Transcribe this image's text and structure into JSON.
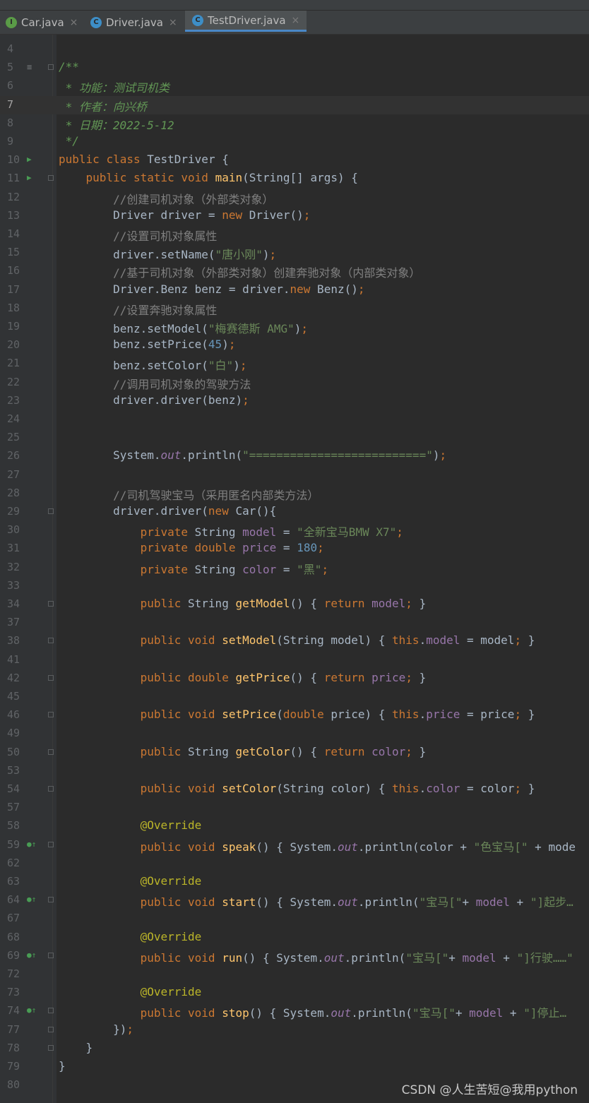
{
  "tabs": [
    {
      "label": "Car.java",
      "icon": "I",
      "icon_color": "#5a9b47",
      "active": false
    },
    {
      "label": "Driver.java",
      "icon": "C",
      "icon_color": "#3d8ec7",
      "active": false
    },
    {
      "label": "TestDriver.java",
      "icon": "C",
      "icon_color": "#3d8ec7",
      "active": true
    }
  ],
  "close_glyph": "×",
  "watermark": "CSDN @人生苦短@我用python",
  "lines": [
    {
      "n": "4",
      "t": ""
    },
    {
      "n": "5",
      "t": "/**"
    },
    {
      "n": "6",
      "t": " * 功能：测试司机类"
    },
    {
      "n": "7",
      "t": " * 作者：向兴桥"
    },
    {
      "n": "8",
      "t": " * 日期：2022-5-12"
    },
    {
      "n": "9",
      "t": " */"
    },
    {
      "n": "10",
      "t": "public class TestDriver {"
    },
    {
      "n": "11",
      "t": "    public static void main(String[] args) {"
    },
    {
      "n": "12",
      "t": "        //创建司机对象（外部类对象）"
    },
    {
      "n": "13",
      "t": "        Driver driver = new Driver();"
    },
    {
      "n": "14",
      "t": "        //设置司机对象属性"
    },
    {
      "n": "15",
      "t": "        driver.setName(\"唐小刚\");"
    },
    {
      "n": "16",
      "t": "        //基于司机对象（外部类对象）创建奔驰对象（内部类对象）"
    },
    {
      "n": "17",
      "t": "        Driver.Benz benz = driver.new Benz();"
    },
    {
      "n": "18",
      "t": "        //设置奔驰对象属性"
    },
    {
      "n": "19",
      "t": "        benz.setModel(\"梅赛德斯 AMG\");"
    },
    {
      "n": "20",
      "t": "        benz.setPrice(45);"
    },
    {
      "n": "21",
      "t": "        benz.setColor(\"白\");"
    },
    {
      "n": "22",
      "t": "        //调用司机对象的驾驶方法"
    },
    {
      "n": "23",
      "t": "        driver.driver(benz);"
    },
    {
      "n": "24",
      "t": ""
    },
    {
      "n": "25",
      "t": ""
    },
    {
      "n": "26",
      "t": "        System.out.println(\"==========================\");"
    },
    {
      "n": "27",
      "t": ""
    },
    {
      "n": "28",
      "t": "        //司机驾驶宝马（采用匿名内部类方法）"
    },
    {
      "n": "29",
      "t": "        driver.driver(new Car(){"
    },
    {
      "n": "30",
      "t": "            private String model = \"全新宝马BMW X7\";"
    },
    {
      "n": "31",
      "t": "            private double price = 180;"
    },
    {
      "n": "32",
      "t": "            private String color = \"黑\";"
    },
    {
      "n": "33",
      "t": ""
    },
    {
      "n": "34",
      "t": "            public String getModel() { return model; }"
    },
    {
      "n": "37",
      "t": ""
    },
    {
      "n": "38",
      "t": "            public void setModel(String model) { this.model = model; }"
    },
    {
      "n": "41",
      "t": ""
    },
    {
      "n": "42",
      "t": "            public double getPrice() { return price; }"
    },
    {
      "n": "45",
      "t": ""
    },
    {
      "n": "46",
      "t": "            public void setPrice(double price) { this.price = price; }"
    },
    {
      "n": "49",
      "t": ""
    },
    {
      "n": "50",
      "t": "            public String getColor() { return color; }"
    },
    {
      "n": "53",
      "t": ""
    },
    {
      "n": "54",
      "t": "            public void setColor(String color) { this.color = color; }"
    },
    {
      "n": "57",
      "t": ""
    },
    {
      "n": "58",
      "t": "            @Override"
    },
    {
      "n": "59",
      "t": "            public void speak() { System.out.println(color + \"色宝马[\" + mode"
    },
    {
      "n": "62",
      "t": ""
    },
    {
      "n": "63",
      "t": "            @Override"
    },
    {
      "n": "64",
      "t": "            public void start() { System.out.println(\"宝马[\"+ model + \"]起步…"
    },
    {
      "n": "67",
      "t": ""
    },
    {
      "n": "68",
      "t": "            @Override"
    },
    {
      "n": "69",
      "t": "            public void run() { System.out.println(\"宝马[\"+ model + \"]行驶……\""
    },
    {
      "n": "72",
      "t": ""
    },
    {
      "n": "73",
      "t": "            @Override"
    },
    {
      "n": "74",
      "t": "            public void stop() { System.out.println(\"宝马[\"+ model + \"]停止…"
    },
    {
      "n": "77",
      "t": "        });"
    },
    {
      "n": "78",
      "t": "    }"
    },
    {
      "n": "79",
      "t": "}"
    },
    {
      "n": "80",
      "t": ""
    }
  ]
}
